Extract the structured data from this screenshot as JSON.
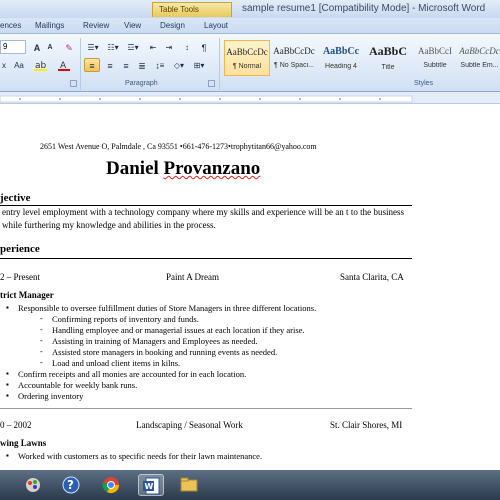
{
  "titlebar": {
    "contextual_tab": "Table Tools",
    "window_title": "sample resume1 [Compatibility Mode] - Microsoft Word"
  },
  "tabs": [
    "ences",
    "Mailings",
    "Review",
    "View",
    "Design",
    "Layout"
  ],
  "ribbon": {
    "font_size": "9",
    "groups": {
      "paragraph": "Paragraph",
      "styles": "Styles"
    },
    "styles": [
      {
        "sample": "AaBbCcDc",
        "name": "¶ Normal",
        "selected": true
      },
      {
        "sample": "AaBbCcDc",
        "name": "¶ No Spaci..."
      },
      {
        "sample": "AaBbCc",
        "name": "Heading 4"
      },
      {
        "sample": "AaBbC",
        "name": "Title"
      },
      {
        "sample": "AaBbCcI",
        "name": "Subtitle"
      },
      {
        "sample": "AaBbCcDc",
        "name": "Subtle Em..."
      }
    ]
  },
  "resume": {
    "contact": "2651 West Avenue O, Palmdale , Ca 93551 •661-476-1273•trophytitan66@yahoo.com",
    "name_first": "Daniel ",
    "name_last": "Provanzano",
    "objective_heading": "jective",
    "objective_text": "entry level employment with a technology company where my skills and experience will be an t to the business while furthering my knowledge and abilities in the process.",
    "experience_heading": "perience",
    "job1": {
      "dates": "2 – Present",
      "company": "Paint A Dream",
      "location": "Santa Clarita, CA",
      "title": "trict Manager",
      "duties": [
        "Responsible to oversee fulfillment duties of Store Managers in three different locations.",
        "Confirm receipts and all monies are accounted for in each location.",
        "Accountable for weekly bank runs.",
        "Ordering inventory"
      ],
      "subduties": [
        "Confirming reports of inventory and funds.",
        "Handling employee and or managerial issues at each location if they arise.",
        "Assisting in training of Managers and Employees as needed.",
        "Assisted store managers in booking and running events as needed.",
        "Load and unload client items in kilns."
      ]
    },
    "job2": {
      "dates": "0 – 2002",
      "company": "Landscaping / Seasonal Work",
      "location": "St. Clair Shores, MI",
      "title": "wing Lawns",
      "duty": "Worked with customers as to specific needs for their lawn maintenance."
    }
  },
  "taskbar": {
    "items": [
      "paint-icon",
      "help-icon",
      "chrome-icon",
      "word-icon",
      "explorer-icon"
    ]
  },
  "colors": {
    "ribbon": "#dce8f7",
    "accent_selected": "#fde19a",
    "taskbar": "#2b3a4c"
  }
}
